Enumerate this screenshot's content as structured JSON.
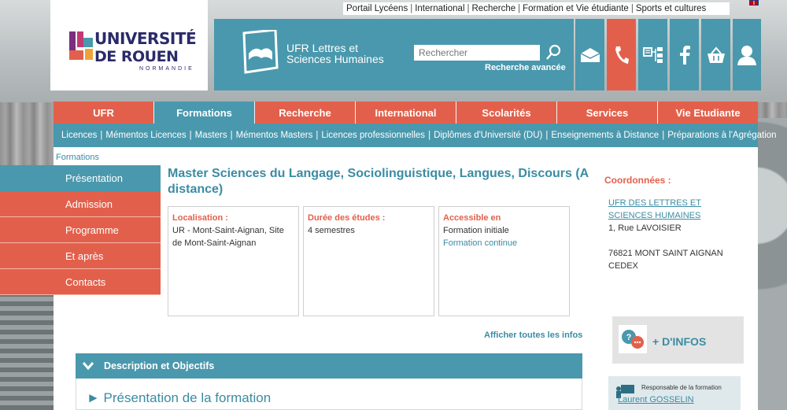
{
  "top_links": [
    "Portail Lycéens",
    "International",
    "Recherche",
    "Formation et Vie étudiante",
    "Sports et cultures"
  ],
  "logo": {
    "line1": "UNIVERSITÉ",
    "line2": "DE ROUEN",
    "line3": "NORMANDIE"
  },
  "ufr": {
    "title_line1": "UFR Lettres et",
    "title_line2": "Sciences Humaines"
  },
  "search": {
    "placeholder": "Rechercher",
    "advanced": "Recherche avancée"
  },
  "icon_tiles": [
    "mail-icon",
    "phone-icon",
    "sitemap-icon",
    "facebook-icon",
    "basket-icon",
    "user-icon"
  ],
  "main_nav": [
    "UFR",
    "Formations",
    "Recherche",
    "International",
    "Scolarités",
    "Services",
    "Vie Etudiante"
  ],
  "main_nav_active": "Formations",
  "sub_nav": [
    "Licences",
    "Mémentos Licences",
    "Masters",
    "Mémentos Masters",
    "Licences professionnelles",
    "Diplômes d'Université (DU)",
    "Enseignements à Distance",
    "Préparations à l'Agrégation"
  ],
  "breadcrumb": "Formations",
  "left_menu": [
    "Présentation",
    "Admission",
    "Programme",
    "Et après",
    "Contacts"
  ],
  "page_title": "Master Sciences du Langage, Sociolinguistique, Langues, Discours (A distance)",
  "info_boxes": [
    {
      "label": "Localisation :",
      "lines": [
        "UR - Mont-Saint-Aignan, Site de Mont-Saint-Aignan"
      ]
    },
    {
      "label": "Durée des études :",
      "lines": [
        "4 semestres"
      ]
    },
    {
      "label": "Accessible en",
      "lines": [
        "Formation initiale"
      ],
      "link": "Formation continue"
    }
  ],
  "show_all": "Afficher toutes les infos",
  "accordion_title": "Description et Objectifs",
  "section_title": "► Présentation de la formation",
  "coordinates": {
    "title": "Coordonnées :",
    "org_link": "UFR DES LETTRES ET SCIENCES HUMAINES",
    "address1": "1, Rue LAVOISIER",
    "address2": "76821 MONT SAINT AIGNAN CEDEX"
  },
  "plus_info": "+ D'INFOS",
  "responsible": {
    "label": "Responsable de la formation",
    "name": "Laurent GOSSELIN"
  },
  "colors": {
    "teal": "#4a98ad",
    "coral": "#e2604b",
    "link": "#3a8ca3"
  }
}
